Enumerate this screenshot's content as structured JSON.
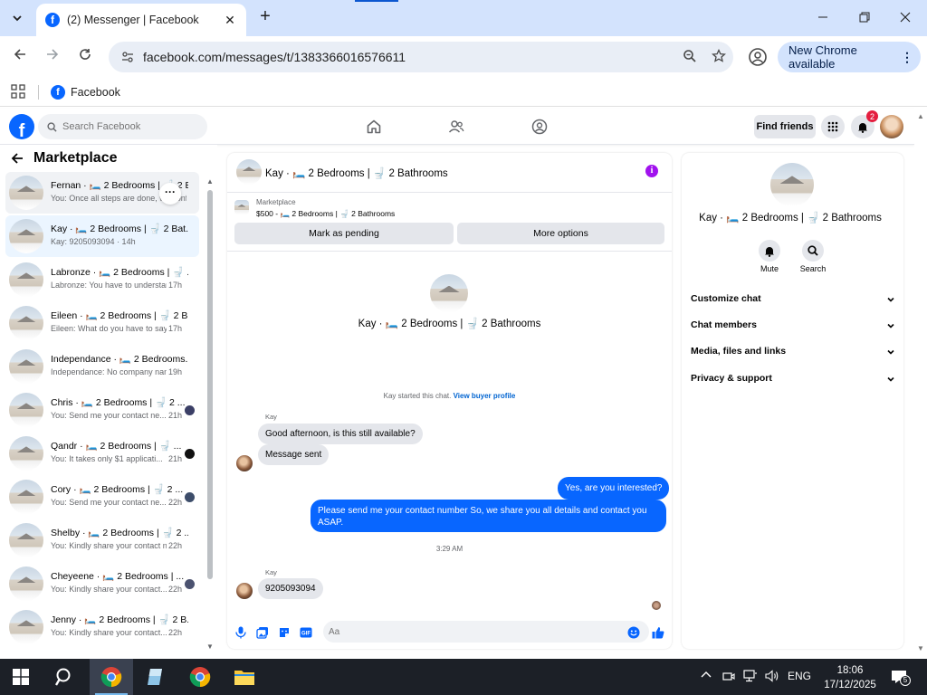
{
  "browser": {
    "tab_title": "(2) Messenger | Facebook",
    "tab_close": "✕",
    "new_tab": "+",
    "url": "facebook.com/messages/t/1383366016576611",
    "update_label": "New Chrome available",
    "bookmark_label": "Facebook"
  },
  "fb": {
    "search_placeholder": "Search Facebook",
    "find_friends": "Find friends",
    "notification_count": "2"
  },
  "sidebar": {
    "title": "Marketplace",
    "conversations": [
      {
        "name": "Fernan · 🛏️ 2 Bedrooms | 🚽 2 Bathrooms",
        "snippet": "You: Once all steps are done, we confirm",
        "time": ""
      },
      {
        "name": "Kay · 🛏️ 2 Bedrooms | 🚽 2 Bat...",
        "snippet": "Kay: 9205093094 · 14h",
        "time": ""
      },
      {
        "name": "Labronze · 🛏️ 2 Bedrooms | 🚽 ...",
        "snippet": "Labronze: You have to understan...",
        "time": "17h"
      },
      {
        "name": "Eileen · 🛏️ 2 Bedrooms | 🚽 2 B...",
        "snippet": "Eileen: What do you have to say ·",
        "time": "17h"
      },
      {
        "name": "Independance · 🛏️ 2 Bedrooms...",
        "snippet": "Independance: No company nam...",
        "time": "19h"
      },
      {
        "name": "Chris · 🛏️ 2 Bedrooms | 🚽 2 ...",
        "snippet": "You: Send me your contact ne...",
        "time": "21h"
      },
      {
        "name": "Qandr · 🛏️ 2 Bedrooms | 🚽 ...",
        "snippet": "You: It takes only $1 applicati...",
        "time": "21h"
      },
      {
        "name": "Cory · 🛏️ 2 Bedrooms | 🚽 2 ...",
        "snippet": "You: Send me your contact ne...",
        "time": "22h"
      },
      {
        "name": "Shelby · 🛏️ 2 Bedrooms | 🚽 2 ...",
        "snippet": "You: Kindly share your contact n...",
        "time": "22h"
      },
      {
        "name": "Cheyeene · 🛏️ 2 Bedrooms | ...",
        "snippet": "You: Kindly share your contact...",
        "time": "22h"
      },
      {
        "name": "Jenny · 🛏️ 2 Bedrooms | 🚽 2 B...",
        "snippet": "You: Kindly share your contact...",
        "time": "22h"
      }
    ],
    "more_label": "···"
  },
  "chat": {
    "title": "Kay · 🛏️ 2 Bedrooms | 🚽 2 Bathrooms",
    "info_label": "i",
    "marketplace_label": "Marketplace",
    "listing": "$500 - 🛏️ 2 Bedrooms | 🚽 2 Bathrooms",
    "mark_pending": "Mark as pending",
    "more_options": "More options",
    "profile_name": "Kay · 🛏️ 2 Bedrooms | 🚽 2 Bathrooms",
    "started_text": "Kay started this chat.",
    "view_profile": "View buyer profile",
    "messages": [
      {
        "sender": "Kay",
        "text": "Good afternoon, is this still available?"
      },
      {
        "sender": "",
        "text": "Message sent"
      },
      {
        "sender": "me",
        "text": "Yes, are you interested?"
      },
      {
        "sender": "me",
        "text": "Please send me your contact number So, we share you all details and contact you ASAP."
      },
      {
        "sender": "Kay",
        "text": "9205093094"
      }
    ],
    "timestamp": "3:29 AM",
    "input_placeholder": "Aa"
  },
  "info_panel": {
    "name": "Kay · 🛏️ 2 Bedrooms | 🚽 2 Bathrooms",
    "mute": "Mute",
    "search": "Search",
    "sections": [
      "Customize chat",
      "Chat members",
      "Media, files and links",
      "Privacy & support"
    ]
  },
  "taskbar": {
    "language": "ENG",
    "time": "18:06",
    "date": "17/12/2025",
    "notif_count": "5"
  },
  "colors": {
    "fb_blue": "#0866ff",
    "active_conv": "#ebf5ff",
    "info_purple": "#a112ee",
    "chrome_tabstrip": "#d3e3fd"
  }
}
